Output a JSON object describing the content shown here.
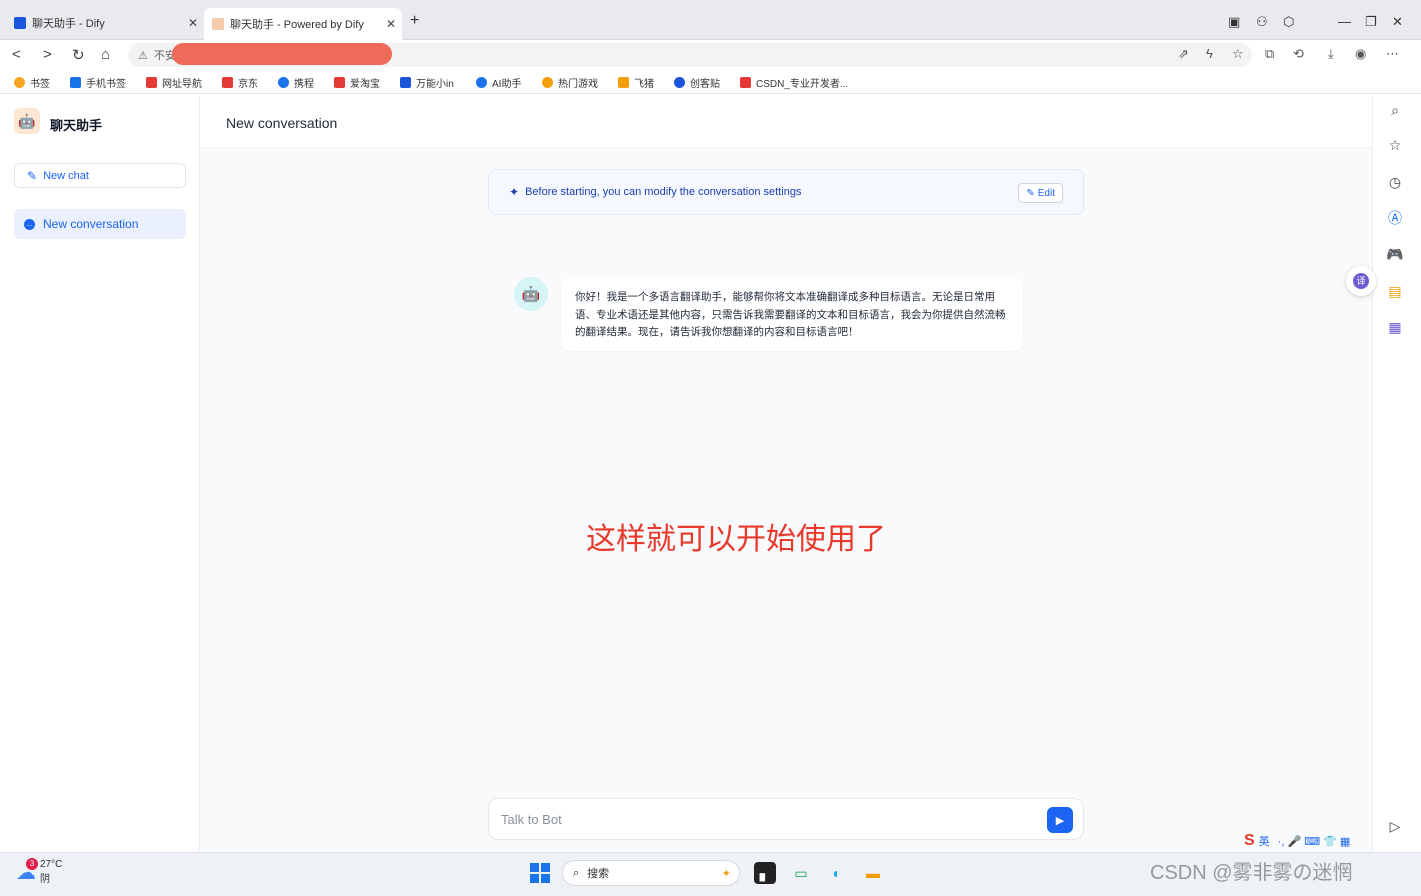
{
  "browser": {
    "tabs": [
      {
        "title": "聊天助手 - Dify",
        "active": false
      },
      {
        "title": "聊天助手 - Powered by Dify",
        "active": true
      }
    ],
    "url_prefix": "不安",
    "bookmarks": [
      {
        "label": "书签",
        "color": "#f5a623"
      },
      {
        "label": "手机书签",
        "color": "#1a73e8"
      },
      {
        "label": "网址导航",
        "color": "#e53935"
      },
      {
        "label": "京东",
        "color": "#e53935"
      },
      {
        "label": "携程",
        "color": "#1a73e8"
      },
      {
        "label": "爱淘宝",
        "color": "#e53935"
      },
      {
        "label": "万能小in",
        "color": "#1a56db"
      },
      {
        "label": "AI助手",
        "color": "#1a73e8"
      },
      {
        "label": "热门游戏",
        "color": "#f59e0b"
      },
      {
        "label": "飞猪",
        "color": "#f59e0b"
      },
      {
        "label": "创客贴",
        "color": "#1a56db"
      },
      {
        "label": "CSDN_专业开发者...",
        "color": "#e53935"
      }
    ]
  },
  "sidebar": {
    "app_name": "聊天助手",
    "new_chat_label": "New chat",
    "conversations": [
      {
        "label": "New conversation",
        "active": true
      }
    ]
  },
  "main": {
    "title": "New conversation",
    "settings_banner": {
      "text": "Before starting, you can modify the conversation settings",
      "edit_label": "Edit"
    },
    "messages": [
      {
        "role": "bot",
        "text": "你好！我是一个多语言翻译助手，能够帮你将文本准确翻译成多种目标语言。无论是日常用语、专业术语还是其他内容，只需告诉我需要翻译的文本和目标语言，我会为你提供自然流畅的翻译结果。现在，请告诉我你想翻译的内容和目标语言吧！"
      }
    ],
    "annotation": "这样就可以开始使用了",
    "composer_placeholder": "Talk to Bot"
  },
  "taskbar": {
    "weather_temp": "27°C",
    "weather_desc": "阴",
    "weather_badge": "3",
    "search_label": "搜索",
    "ime_label": "英"
  },
  "watermark": "CSDN @雾非雾の迷惘",
  "colors": {
    "accent": "#1c64f2",
    "annotation": "#e8392c",
    "redaction": "#ee6b5a"
  }
}
